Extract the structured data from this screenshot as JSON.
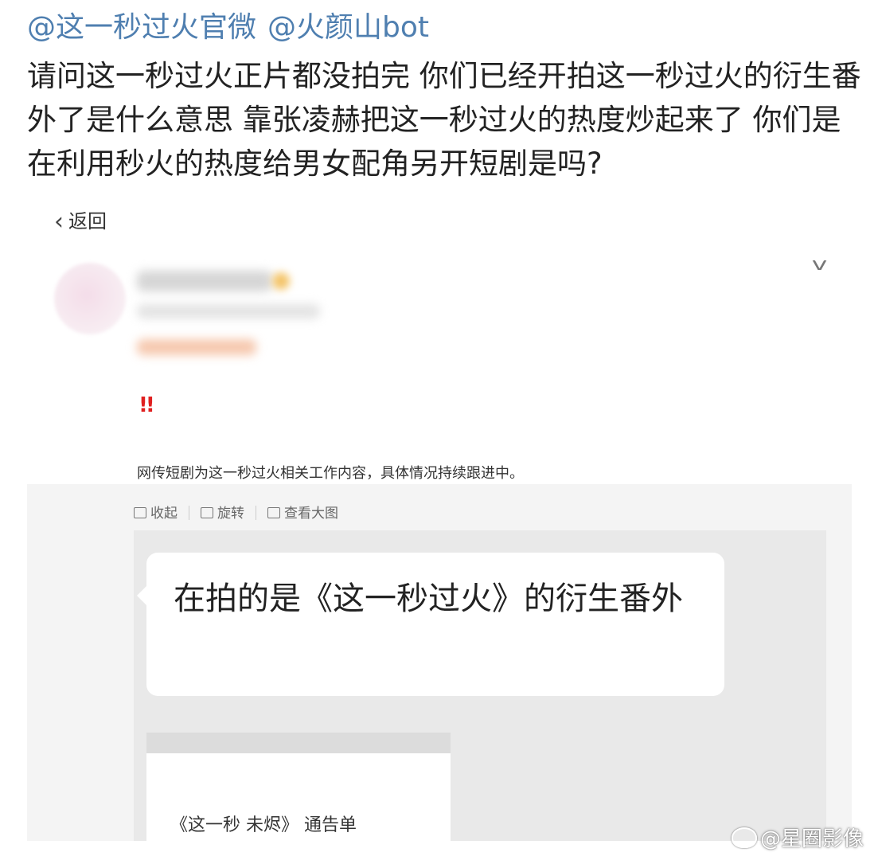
{
  "mentions": [
    "@这一秒过火官微",
    "@火颜山bot"
  ],
  "post_text": "请问这一秒过火正片都没拍完 你们已经开拍这一秒过火的衍生番外了是什么意思 靠张凌赫把这一秒过火的热度炒起来了 你们是在利用秒火的热度给男女配角另开短剧是吗?",
  "screenshot": {
    "back_label": "返回",
    "exclaim": "!!",
    "caption": "网传短剧为这一秒过火相关工作内容，具体情况持续跟进中。",
    "tools": [
      "收起",
      "旋转",
      "查看大图"
    ],
    "bubble_text": "在拍的是《这一秒过火》的衍生番外",
    "card_text": "《这一秒 未烬》 通告单"
  },
  "watermark": "@星圈影像"
}
